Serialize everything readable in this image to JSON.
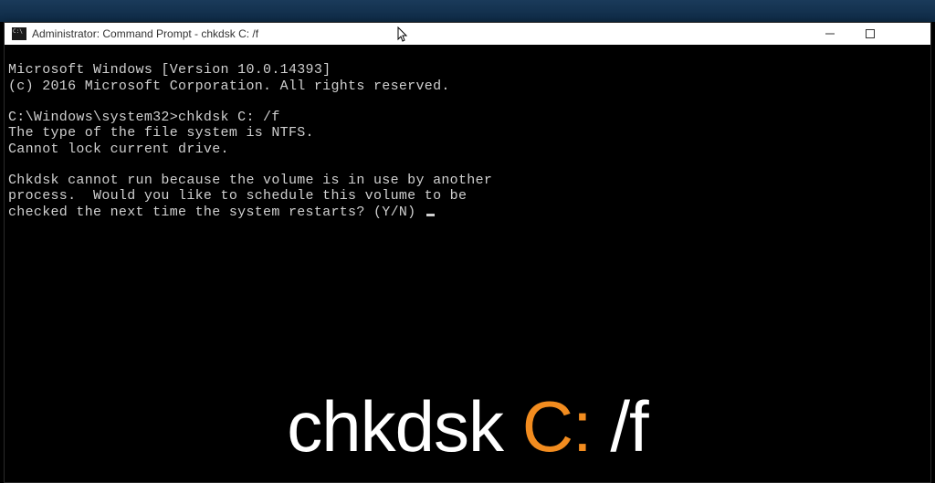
{
  "window": {
    "title": "Administrator: Command Prompt - chkdsk C: /f"
  },
  "terminal": {
    "line1": "Microsoft Windows [Version 10.0.14393]",
    "line2": "(c) 2016 Microsoft Corporation. All rights reserved.",
    "blank1": "",
    "prompt_path": "C:\\Windows\\system32>",
    "prompt_cmd": "chkdsk C: /f",
    "line4": "The type of the file system is NTFS.",
    "line5": "Cannot lock current drive.",
    "blank2": "",
    "line6": "Chkdsk cannot run because the volume is in use by another",
    "line7": "process.  Would you like to schedule this volume to be",
    "line8": "checked the next time the system restarts? (Y/N) "
  },
  "caption": {
    "part1": "chkdsk ",
    "part2_accent": "C:",
    "part3": " /f"
  }
}
